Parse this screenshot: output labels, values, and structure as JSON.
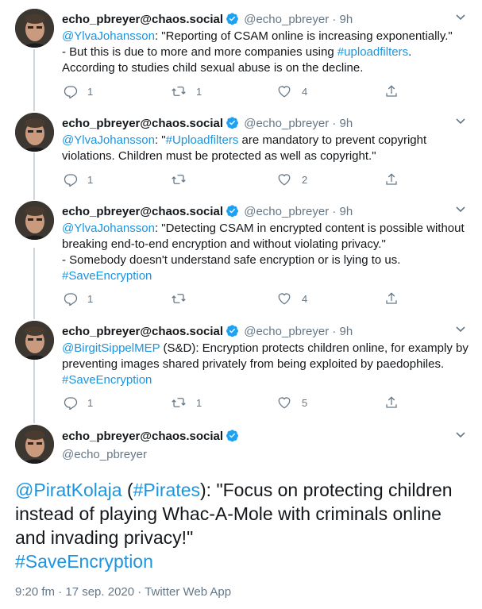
{
  "author": {
    "name": "echo_pbreyer@chaos.social",
    "handle": "@echo_pbreyer",
    "time": "9h"
  },
  "tweets": [
    {
      "mention": "@YlvaJohansson",
      "text_a": ": \"Reporting of CSAM online is increasing exponentially.\"\n- But this is due to more and more companies using ",
      "hashtag": "#uploadfilters",
      "text_b": ".\nAccording to studies child sexual abuse is on the decline.",
      "replies": "1",
      "retweets": "1",
      "likes": "4"
    },
    {
      "mention": "@YlvaJohansson",
      "text_a": ": \"",
      "hashtag": "#Uploadfilters",
      "text_b": " are mandatory to prevent copyright violations. Children must be protected as well as copyright.\"",
      "replies": "1",
      "retweets": "",
      "likes": "2"
    },
    {
      "mention": "@YlvaJohansson",
      "text_a": ": \"Detecting CSAM in encrypted content is possible without breaking end-to-end encryption and without violating privacy.\"\n- Somebody doesn't understand safe encryption or is lying to us.\n",
      "hashtag": "#SaveEncryption",
      "text_b": "",
      "replies": "1",
      "retweets": "",
      "likes": "4"
    },
    {
      "mention": "@BirgitSippelMEP",
      "text_a": " (S&D): Encryption protects children online, for examply by preventing images shared privately from being exploited by paedophiles.\n",
      "hashtag": "#SaveEncryption",
      "text_b": "",
      "replies": "1",
      "retweets": "1",
      "likes": "5"
    }
  ],
  "main_tweet": {
    "mention": "@PiratKolaja",
    "paren_open": " (",
    "hashtag1": "#Pirates",
    "text": "): \"Focus on protecting children instead of playing Whac-A-Mole with criminals online and invading privacy!\"",
    "hashtag2": "#SaveEncryption",
    "meta": "9:20 fm · 17 sep. 2020 · Twitter Web App"
  },
  "separator": "·",
  "icons": [
    "reply-icon",
    "retweet-icon",
    "like-icon",
    "share-icon",
    "verified-badge-icon",
    "chevron-down-icon"
  ],
  "colors": {
    "link": "#1b95e0",
    "muted": "#657786",
    "verified": "#1da1f2",
    "thread_line": "#ccd6dd"
  }
}
